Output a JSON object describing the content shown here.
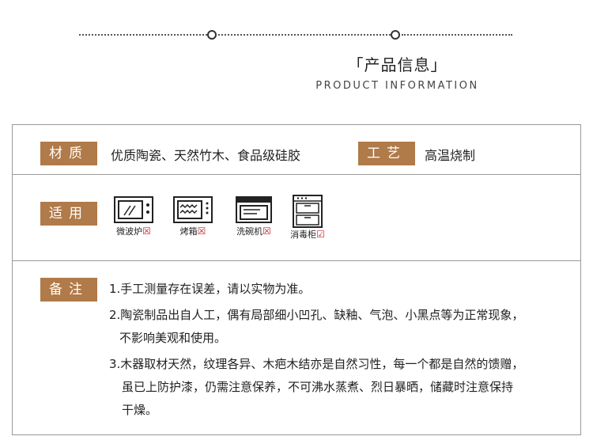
{
  "header": {
    "title": "「产品信息」",
    "subtitle": "PRODUCT INFORMATION"
  },
  "material": {
    "label": "材质",
    "value": "优质陶瓷、天然竹木、食品级硅胶"
  },
  "craft": {
    "label": "工艺",
    "value": "高温烧制"
  },
  "usage": {
    "label": "适用",
    "items": [
      {
        "icon": "microwave-icon",
        "name": "微波炉",
        "status": "not-suitable",
        "mark": "☒"
      },
      {
        "icon": "oven-icon",
        "name": "烤箱",
        "status": "not-suitable",
        "mark": "☒"
      },
      {
        "icon": "dishwasher-icon",
        "name": "洗碗机",
        "status": "not-suitable",
        "mark": "☒"
      },
      {
        "icon": "disinfection-cabinet-icon",
        "name": "消毒柜",
        "status": "suitable",
        "mark": "☑"
      }
    ]
  },
  "notes": {
    "label": "备注",
    "lines": [
      "1.手工测量存在误差，请以实物为准。",
      "2.陶瓷制品出自人工，偶有局部细小凹孔、缺釉、气泡、小黑点等为正常现象，",
      "不影响美观和使用。",
      "3.木器取材天然，纹理各异、木疤木结亦是自然习性，每一个都是自然的馈赠，",
      "虽已上防护漆，仍需注意保养，不可沸水蒸煮、烈日暴晒，储藏时注意保持",
      "干燥。"
    ]
  },
  "colors": {
    "accent": "#b07a49",
    "check_red": "#c0282c",
    "border": "#999999"
  }
}
